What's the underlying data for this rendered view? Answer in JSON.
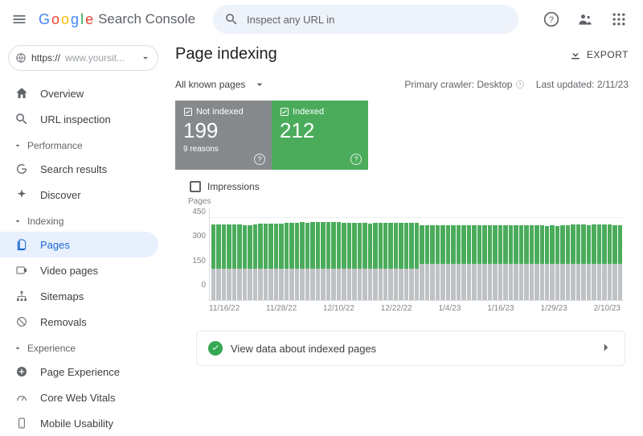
{
  "app": {
    "name_parts": [
      "G",
      "o",
      "o",
      "g",
      "l",
      "e"
    ],
    "subtitle": "Search Console"
  },
  "search": {
    "placeholder": "Inspect any URL in"
  },
  "property": {
    "prefix": "https://",
    "site": "www.yoursit..."
  },
  "nav": {
    "overview": "Overview",
    "url_inspection": "URL inspection",
    "performance_group": "Performance",
    "search_results": "Search results",
    "discover": "Discover",
    "indexing_group": "Indexing",
    "pages": "Pages",
    "video_pages": "Video pages",
    "sitemaps": "Sitemaps",
    "removals": "Removals",
    "experience_group": "Experience",
    "page_experience": "Page Experience",
    "core_web_vitals": "Core Web Vitals",
    "mobile_usability": "Mobile Usability"
  },
  "header": {
    "title": "Page indexing",
    "export": "EXPORT"
  },
  "filters": {
    "all_known": "All known pages",
    "primary_crawler_label": "Primary crawler:",
    "primary_crawler_value": "Desktop",
    "last_updated_label": "Last updated:",
    "last_updated_value": "2/11/23"
  },
  "cards": {
    "not_indexed": {
      "label": "Not indexed",
      "value": "199",
      "sub": "9 reasons"
    },
    "indexed": {
      "label": "Indexed",
      "value": "212"
    }
  },
  "impressions": {
    "label": "Impressions"
  },
  "chart_data": {
    "type": "bar",
    "ylabel": "Pages",
    "ylim": [
      0,
      450
    ],
    "yticks": [
      0,
      150,
      300,
      450
    ],
    "xticks": [
      "11/16/22",
      "11/28/22",
      "12/10/22",
      "12/22/22",
      "1/4/23",
      "1/16/23",
      "1/29/23",
      "2/10/23"
    ],
    "colors": {
      "indexed": "#4aac5b",
      "not_indexed": "#bfc2c4"
    },
    "series": [
      {
        "name": "Indexed",
        "values": [
          245,
          244,
          245,
          243,
          245,
          244,
          240,
          242,
          246,
          247,
          250,
          251,
          249,
          250,
          253,
          255,
          254,
          256,
          255,
          257,
          258,
          256,
          257,
          256,
          257,
          254,
          255,
          254,
          253,
          254,
          250,
          253,
          255,
          254,
          255,
          253,
          254,
          253,
          252,
          253,
          209,
          210,
          210,
          211,
          210,
          212,
          210,
          211,
          211,
          210,
          210,
          211,
          212,
          210,
          210,
          210,
          211,
          211,
          211,
          210,
          210,
          209,
          210,
          211,
          208,
          209,
          207,
          210,
          212,
          213,
          215,
          214,
          213,
          216,
          217,
          215,
          214,
          213,
          212
        ]
      },
      {
        "name": "Not indexed",
        "values": [
          170,
          170,
          170,
          170,
          170,
          170,
          170,
          170,
          170,
          170,
          170,
          170,
          170,
          170,
          170,
          170,
          170,
          170,
          170,
          170,
          170,
          170,
          170,
          170,
          170,
          170,
          170,
          170,
          170,
          170,
          170,
          170,
          170,
          170,
          170,
          170,
          170,
          170,
          170,
          170,
          200,
          200,
          200,
          200,
          200,
          200,
          200,
          200,
          200,
          200,
          200,
          200,
          200,
          200,
          200,
          200,
          200,
          200,
          200,
          200,
          200,
          200,
          200,
          200,
          200,
          200,
          200,
          200,
          200,
          200,
          200,
          200,
          198,
          198,
          199,
          199,
          199,
          199,
          199
        ]
      }
    ]
  },
  "view_indexed": {
    "label": "View data about indexed pages"
  }
}
